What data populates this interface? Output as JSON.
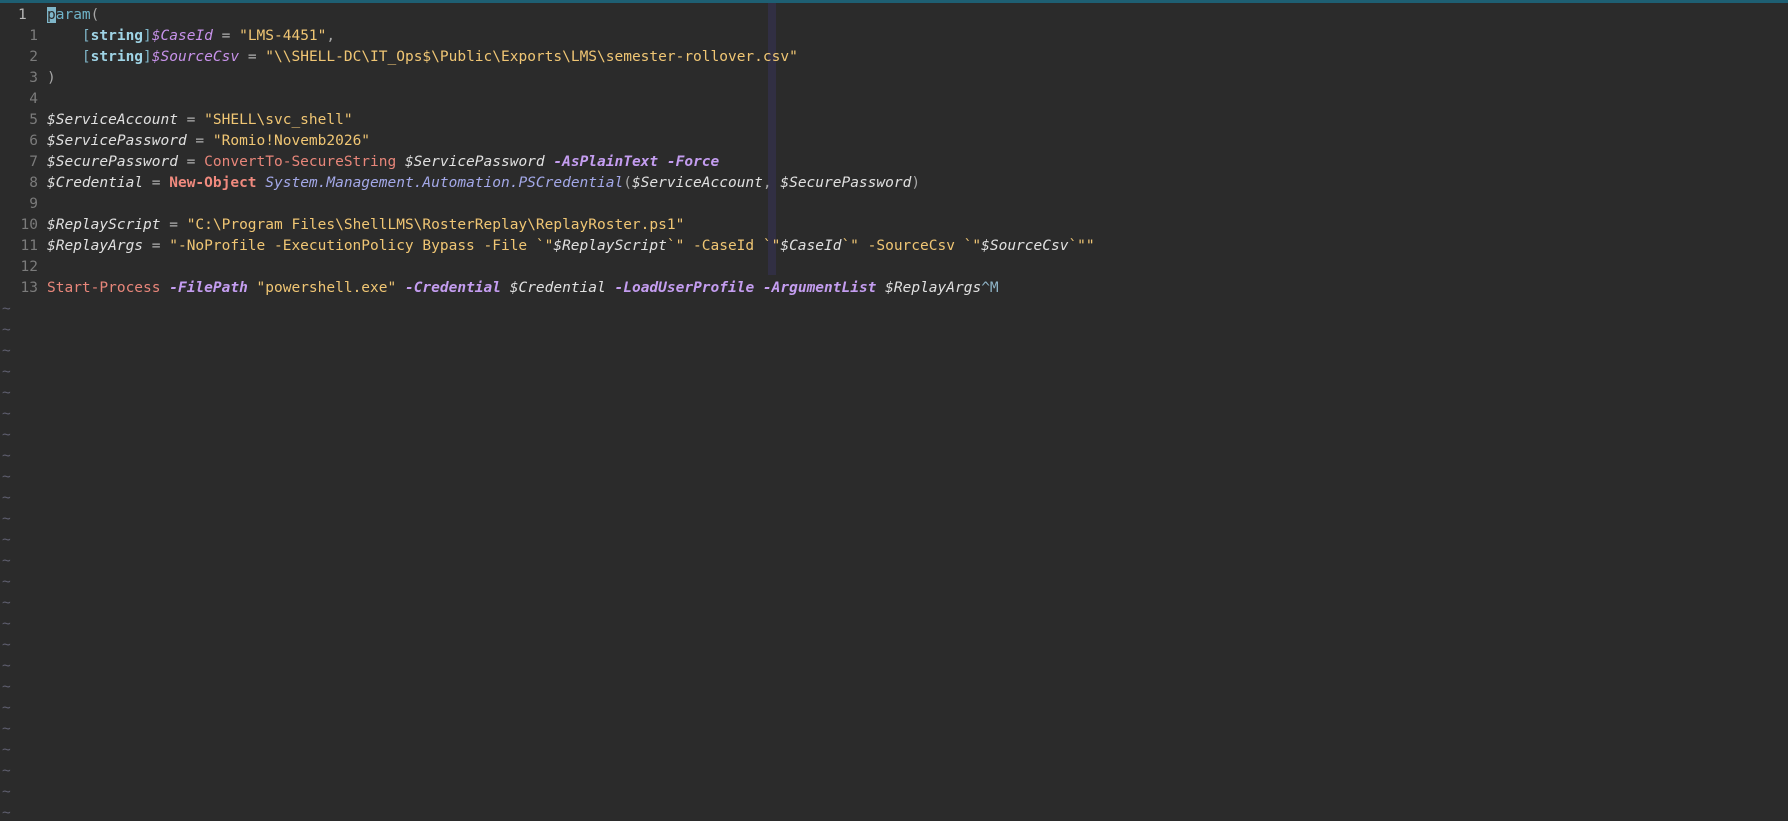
{
  "editor": {
    "lines": [
      {
        "num": "1",
        "current": true,
        "tokens": [
          {
            "t": "p",
            "c": "cursor"
          },
          {
            "t": "aram",
            "c": "t-kw"
          },
          {
            "t": "(",
            "c": "t-punct"
          }
        ]
      },
      {
        "num": "1",
        "tokens": [
          {
            "t": "    ",
            "c": "t-default"
          },
          {
            "t": "[",
            "c": "t-typebr"
          },
          {
            "t": "string",
            "c": "t-type"
          },
          {
            "t": "]",
            "c": "t-typebr"
          },
          {
            "t": "$CaseId",
            "c": "t-param"
          },
          {
            "t": " = ",
            "c": "t-op"
          },
          {
            "t": "\"LMS-4451\"",
            "c": "t-str"
          },
          {
            "t": ",",
            "c": "t-punct"
          }
        ]
      },
      {
        "num": "2",
        "tokens": [
          {
            "t": "    ",
            "c": "t-default"
          },
          {
            "t": "[",
            "c": "t-typebr"
          },
          {
            "t": "string",
            "c": "t-type"
          },
          {
            "t": "]",
            "c": "t-typebr"
          },
          {
            "t": "$SourceCsv",
            "c": "t-param"
          },
          {
            "t": " = ",
            "c": "t-op"
          },
          {
            "t": "\"\\\\SHELL-DC\\IT_Ops$\\Public\\Exports\\LMS\\semester-rollover.csv\"",
            "c": "t-str"
          }
        ]
      },
      {
        "num": "3",
        "tokens": [
          {
            "t": ")",
            "c": "t-punct"
          }
        ]
      },
      {
        "num": "4",
        "tokens": []
      },
      {
        "num": "5",
        "tokens": [
          {
            "t": "$ServiceAccount",
            "c": "t-var"
          },
          {
            "t": " = ",
            "c": "t-op"
          },
          {
            "t": "\"SHELL\\svc_shell\"",
            "c": "t-str"
          }
        ]
      },
      {
        "num": "6",
        "tokens": [
          {
            "t": "$ServicePassword",
            "c": "t-var"
          },
          {
            "t": " = ",
            "c": "t-op"
          },
          {
            "t": "\"Romio!Novemb2026\"",
            "c": "t-str"
          }
        ]
      },
      {
        "num": "7",
        "tokens": [
          {
            "t": "$SecurePassword",
            "c": "t-var"
          },
          {
            "t": " = ",
            "c": "t-op"
          },
          {
            "t": "ConvertTo-SecureString",
            "c": "t-cmd"
          },
          {
            "t": " ",
            "c": "t-default"
          },
          {
            "t": "$ServicePassword",
            "c": "t-var"
          },
          {
            "t": " ",
            "c": "t-default"
          },
          {
            "t": "-AsPlainText",
            "c": "t-flag"
          },
          {
            "t": " ",
            "c": "t-default"
          },
          {
            "t": "-Force",
            "c": "t-flag"
          }
        ]
      },
      {
        "num": "8",
        "tokens": [
          {
            "t": "$Credential",
            "c": "t-var"
          },
          {
            "t": " = ",
            "c": "t-op"
          },
          {
            "t": "New-Object",
            "c": "t-cmdbold"
          },
          {
            "t": " ",
            "c": "t-default"
          },
          {
            "t": "System.Management.Automation.PSCredential",
            "c": "t-class"
          },
          {
            "t": "(",
            "c": "t-punct"
          },
          {
            "t": "$ServiceAccount",
            "c": "t-var"
          },
          {
            "t": ", ",
            "c": "t-punct"
          },
          {
            "t": "$SecurePassword",
            "c": "t-var"
          },
          {
            "t": ")",
            "c": "t-punct"
          }
        ]
      },
      {
        "num": "9",
        "tokens": []
      },
      {
        "num": "10",
        "tokens": [
          {
            "t": "$ReplayScript",
            "c": "t-var"
          },
          {
            "t": " = ",
            "c": "t-op"
          },
          {
            "t": "\"C:\\Program Files\\ShellLMS\\RosterReplay\\ReplayRoster.ps1\"",
            "c": "t-str"
          }
        ]
      },
      {
        "num": "11",
        "tokens": [
          {
            "t": "$ReplayArgs",
            "c": "t-var"
          },
          {
            "t": " = ",
            "c": "t-op"
          },
          {
            "t": "\"-NoProfile -ExecutionPolicy Bypass -File `\"",
            "c": "t-str"
          },
          {
            "t": "$ReplayScript",
            "c": "t-var"
          },
          {
            "t": "`\" -CaseId `\"",
            "c": "t-str"
          },
          {
            "t": "$CaseId",
            "c": "t-var"
          },
          {
            "t": "`\" -SourceCsv `\"",
            "c": "t-str"
          },
          {
            "t": "$SourceCsv",
            "c": "t-var"
          },
          {
            "t": "`\"\"",
            "c": "t-str"
          }
        ]
      },
      {
        "num": "12",
        "tokens": []
      },
      {
        "num": "13",
        "tokens": [
          {
            "t": "Start-Process",
            "c": "t-cmd"
          },
          {
            "t": " ",
            "c": "t-default"
          },
          {
            "t": "-FilePath",
            "c": "t-flag"
          },
          {
            "t": " ",
            "c": "t-default"
          },
          {
            "t": "\"powershell.exe\"",
            "c": "t-str"
          },
          {
            "t": " ",
            "c": "t-default"
          },
          {
            "t": "-Credential",
            "c": "t-flag"
          },
          {
            "t": " ",
            "c": "t-default"
          },
          {
            "t": "$Credential",
            "c": "t-var"
          },
          {
            "t": " ",
            "c": "t-default"
          },
          {
            "t": "-LoadUserProfile",
            "c": "t-flag"
          },
          {
            "t": " ",
            "c": "t-default"
          },
          {
            "t": "-ArgumentList",
            "c": "t-flag"
          },
          {
            "t": " ",
            "c": "t-default"
          },
          {
            "t": "$ReplayArgs",
            "c": "t-var"
          },
          {
            "t": "^M",
            "c": "t-ctl"
          }
        ]
      }
    ],
    "empty_line_marker": "~",
    "empty_line_count": 25
  },
  "colors": {
    "background": "#2b2b2b",
    "string": "#f0c674",
    "variable": "#e0e0e0",
    "parameter_flag": "#c49df0",
    "cmdlet": "#e8867a",
    "keyword": "#6fb3c8",
    "line_number": "#7b7b7b",
    "top_accent": "#1e5f73"
  }
}
